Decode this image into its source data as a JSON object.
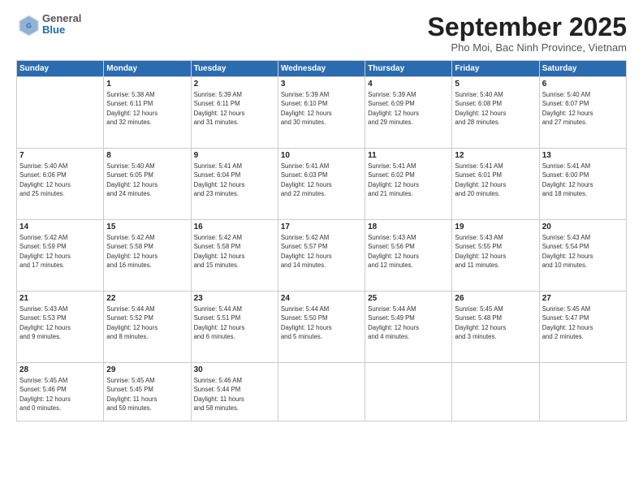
{
  "header": {
    "logo": {
      "general": "General",
      "blue": "Blue"
    },
    "title": "September 2025",
    "subtitle": "Pho Moi, Bac Ninh Province, Vietnam"
  },
  "calendar": {
    "days_of_week": [
      "Sunday",
      "Monday",
      "Tuesday",
      "Wednesday",
      "Thursday",
      "Friday",
      "Saturday"
    ],
    "weeks": [
      [
        {
          "day": "",
          "info": ""
        },
        {
          "day": "1",
          "info": "Sunrise: 5:38 AM\nSunset: 6:11 PM\nDaylight: 12 hours\nand 32 minutes."
        },
        {
          "day": "2",
          "info": "Sunrise: 5:39 AM\nSunset: 6:11 PM\nDaylight: 12 hours\nand 31 minutes."
        },
        {
          "day": "3",
          "info": "Sunrise: 5:39 AM\nSunset: 6:10 PM\nDaylight: 12 hours\nand 30 minutes."
        },
        {
          "day": "4",
          "info": "Sunrise: 5:39 AM\nSunset: 6:09 PM\nDaylight: 12 hours\nand 29 minutes."
        },
        {
          "day": "5",
          "info": "Sunrise: 5:40 AM\nSunset: 6:08 PM\nDaylight: 12 hours\nand 28 minutes."
        },
        {
          "day": "6",
          "info": "Sunrise: 5:40 AM\nSunset: 6:07 PM\nDaylight: 12 hours\nand 27 minutes."
        }
      ],
      [
        {
          "day": "7",
          "info": "Sunrise: 5:40 AM\nSunset: 6:06 PM\nDaylight: 12 hours\nand 25 minutes."
        },
        {
          "day": "8",
          "info": "Sunrise: 5:40 AM\nSunset: 6:05 PM\nDaylight: 12 hours\nand 24 minutes."
        },
        {
          "day": "9",
          "info": "Sunrise: 5:41 AM\nSunset: 6:04 PM\nDaylight: 12 hours\nand 23 minutes."
        },
        {
          "day": "10",
          "info": "Sunrise: 5:41 AM\nSunset: 6:03 PM\nDaylight: 12 hours\nand 22 minutes."
        },
        {
          "day": "11",
          "info": "Sunrise: 5:41 AM\nSunset: 6:02 PM\nDaylight: 12 hours\nand 21 minutes."
        },
        {
          "day": "12",
          "info": "Sunrise: 5:41 AM\nSunset: 6:01 PM\nDaylight: 12 hours\nand 20 minutes."
        },
        {
          "day": "13",
          "info": "Sunrise: 5:41 AM\nSunset: 6:00 PM\nDaylight: 12 hours\nand 18 minutes."
        }
      ],
      [
        {
          "day": "14",
          "info": "Sunrise: 5:42 AM\nSunset: 5:59 PM\nDaylight: 12 hours\nand 17 minutes."
        },
        {
          "day": "15",
          "info": "Sunrise: 5:42 AM\nSunset: 5:58 PM\nDaylight: 12 hours\nand 16 minutes."
        },
        {
          "day": "16",
          "info": "Sunrise: 5:42 AM\nSunset: 5:58 PM\nDaylight: 12 hours\nand 15 minutes."
        },
        {
          "day": "17",
          "info": "Sunrise: 5:42 AM\nSunset: 5:57 PM\nDaylight: 12 hours\nand 14 minutes."
        },
        {
          "day": "18",
          "info": "Sunrise: 5:43 AM\nSunset: 5:56 PM\nDaylight: 12 hours\nand 12 minutes."
        },
        {
          "day": "19",
          "info": "Sunrise: 5:43 AM\nSunset: 5:55 PM\nDaylight: 12 hours\nand 11 minutes."
        },
        {
          "day": "20",
          "info": "Sunrise: 5:43 AM\nSunset: 5:54 PM\nDaylight: 12 hours\nand 10 minutes."
        }
      ],
      [
        {
          "day": "21",
          "info": "Sunrise: 5:43 AM\nSunset: 5:53 PM\nDaylight: 12 hours\nand 9 minutes."
        },
        {
          "day": "22",
          "info": "Sunrise: 5:44 AM\nSunset: 5:52 PM\nDaylight: 12 hours\nand 8 minutes."
        },
        {
          "day": "23",
          "info": "Sunrise: 5:44 AM\nSunset: 5:51 PM\nDaylight: 12 hours\nand 6 minutes."
        },
        {
          "day": "24",
          "info": "Sunrise: 5:44 AM\nSunset: 5:50 PM\nDaylight: 12 hours\nand 5 minutes."
        },
        {
          "day": "25",
          "info": "Sunrise: 5:44 AM\nSunset: 5:49 PM\nDaylight: 12 hours\nand 4 minutes."
        },
        {
          "day": "26",
          "info": "Sunrise: 5:45 AM\nSunset: 5:48 PM\nDaylight: 12 hours\nand 3 minutes."
        },
        {
          "day": "27",
          "info": "Sunrise: 5:45 AM\nSunset: 5:47 PM\nDaylight: 12 hours\nand 2 minutes."
        }
      ],
      [
        {
          "day": "28",
          "info": "Sunrise: 5:45 AM\nSunset: 5:46 PM\nDaylight: 12 hours\nand 0 minutes."
        },
        {
          "day": "29",
          "info": "Sunrise: 5:45 AM\nSunset: 5:45 PM\nDaylight: 11 hours\nand 59 minutes."
        },
        {
          "day": "30",
          "info": "Sunrise: 5:46 AM\nSunset: 5:44 PM\nDaylight: 11 hours\nand 58 minutes."
        },
        {
          "day": "",
          "info": ""
        },
        {
          "day": "",
          "info": ""
        },
        {
          "day": "",
          "info": ""
        },
        {
          "day": "",
          "info": ""
        }
      ]
    ]
  }
}
